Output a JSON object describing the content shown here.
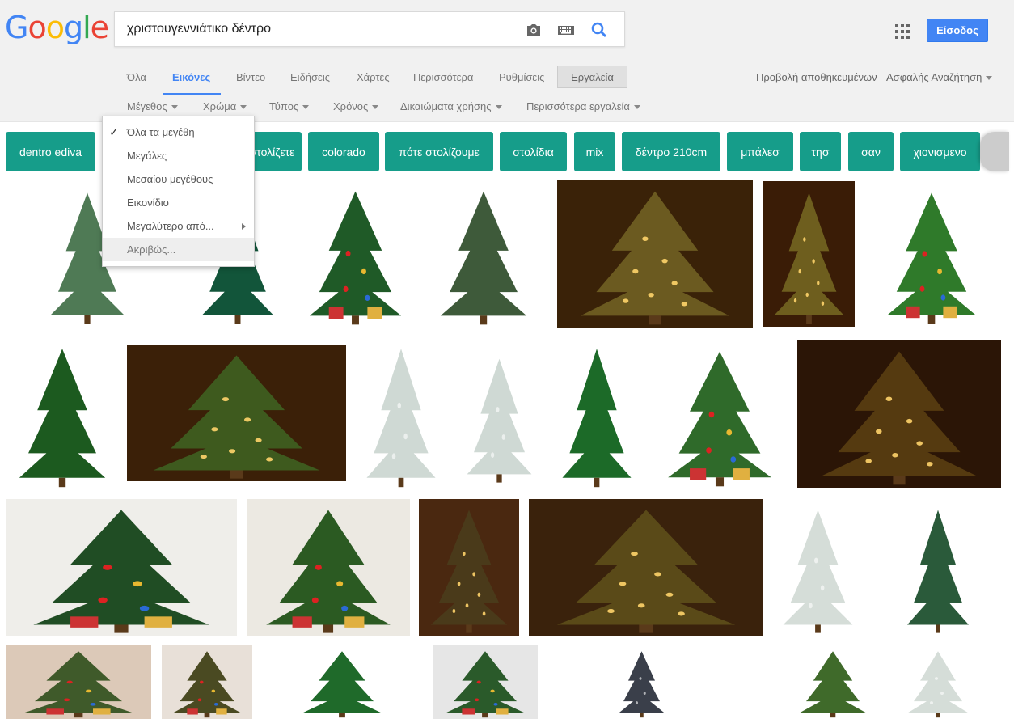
{
  "logo": {
    "letters": [
      "G",
      "o",
      "o",
      "g",
      "l",
      "e"
    ],
    "colors": [
      "#4285f4",
      "#ea4335",
      "#fbbc05",
      "#4285f4",
      "#34a853",
      "#ea4335"
    ]
  },
  "search": {
    "query": "χριστουγεννιάτικο δέντρο"
  },
  "header": {
    "signin_label": "Είσοδος"
  },
  "tabs": [
    {
      "label": "Όλα"
    },
    {
      "label": "Εικόνες",
      "active": true
    },
    {
      "label": "Βίντεο"
    },
    {
      "label": "Ειδήσεις"
    },
    {
      "label": "Χάρτες"
    },
    {
      "label": "Περισσότερα"
    },
    {
      "label": "Ρυθμίσεις"
    }
  ],
  "tools_label": "Εργαλεία",
  "right_links": {
    "saved": "Προβολή αποθηκευμένων",
    "safe_search": "Ασφαλής Αναζήτηση"
  },
  "tool_filters": [
    "Μέγεθος",
    "Χρώμα",
    "Τύπος",
    "Χρόνος",
    "Δικαιώματα χρήσης",
    "Περισσότερα εργαλεία"
  ],
  "chips": [
    "dentro ediva",
    "στολίζετε",
    "colorado",
    "πότε στολίζουμε",
    "στολίδια",
    "mix",
    "δέντρο 210cm",
    "μπάλεσ",
    "τησ",
    "σαν",
    "χιονισμενο"
  ],
  "size_menu": {
    "items": [
      {
        "label": "Όλα τα μεγέθη",
        "checked": true
      },
      {
        "label": "Μεγάλες"
      },
      {
        "label": "Μεσαίου μεγέθους"
      },
      {
        "label": "Εικονίδιο"
      },
      {
        "label": "Μεγαλύτερο από...",
        "submenu": true
      },
      {
        "label": "Ακριβώς...",
        "hovered": true
      }
    ]
  },
  "colors": {
    "accent": "#4285f4",
    "chip": "#169d8a",
    "header_bg": "#f1f1f1"
  }
}
